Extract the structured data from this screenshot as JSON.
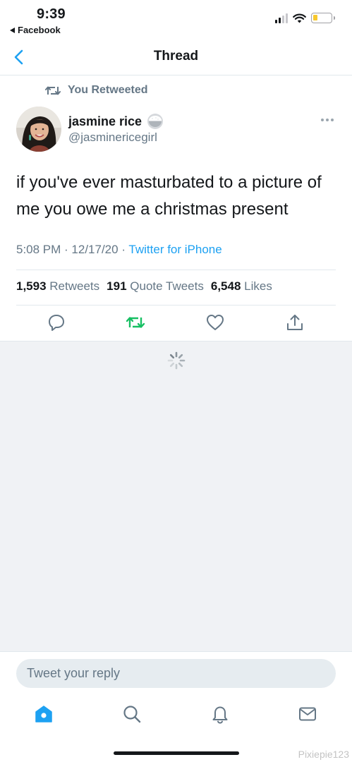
{
  "status_bar": {
    "time": "9:39",
    "back_app": "Facebook",
    "battery_color": "#f7c82e"
  },
  "nav": {
    "title": "Thread",
    "back_icon": "chevron-left-icon"
  },
  "tweet": {
    "retweet_context": "You Retweeted",
    "user_name": "jasmine rice",
    "user_emoji": "rice-bowl-emoji",
    "user_handle": "@jasminericegirl",
    "text": "if you've ever masturbated to a picture of me you owe me a christmas present",
    "time": "5:08 PM",
    "date": "12/17/20",
    "separator": " · ",
    "source": "Twitter for iPhone",
    "stats": {
      "retweets_count": "1,593",
      "retweets_label": "Retweets",
      "quotes_count": "191",
      "quotes_label": "Quote Tweets",
      "likes_count": "6,548",
      "likes_label": "Likes"
    },
    "retweeted": true,
    "retweet_color": "#17bf63"
  },
  "actions": [
    "reply-icon",
    "retweet-icon",
    "like-icon",
    "share-icon"
  ],
  "reply": {
    "placeholder": "Tweet your reply"
  },
  "tabbar": {
    "items": [
      "home-icon",
      "search-icon",
      "notifications-icon",
      "messages-icon"
    ],
    "active": "home-icon",
    "accent": "#1da1f2"
  },
  "watermark": "Pixiepie123"
}
